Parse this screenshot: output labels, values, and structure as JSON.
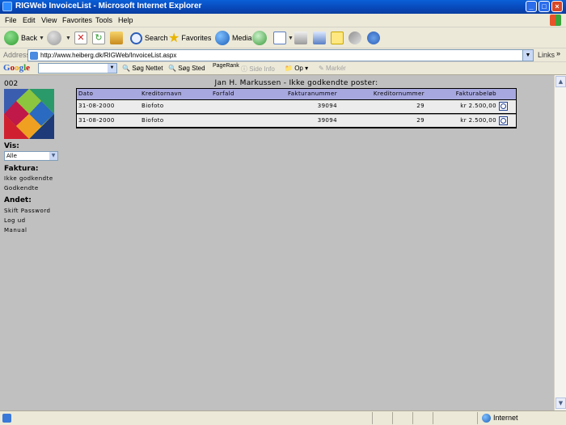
{
  "window": {
    "title": "RIGWeb InvoiceList - Microsoft Internet Explorer"
  },
  "menu": [
    "File",
    "Edit",
    "View",
    "Favorites",
    "Tools",
    "Help"
  ],
  "toolbar": {
    "back": "Back",
    "search": "Search",
    "favorites": "Favorites",
    "media": "Media"
  },
  "address": {
    "label": "Address",
    "url": "http://www.heiberg.dk/RIGWeb/InvoiceList.aspx",
    "links": "Links",
    "more": "»"
  },
  "googlebar": {
    "logo": "Google",
    "search_web": "Søg Nettet",
    "search_site": "Søg Sted",
    "pagerank": "PageRank",
    "page_info": "Side Info",
    "up": "Op",
    "highlight": "Markér"
  },
  "sidebar": {
    "user_id": "002",
    "vis_label": "Vis:",
    "vis_value": "Alle",
    "faktura_heading": "Faktura:",
    "faktura_links": [
      "Ikke godkendte",
      "Godkendte"
    ],
    "andet_heading": "Andet:",
    "andet_links": [
      "Skift Password",
      "Log ud",
      "Manual"
    ]
  },
  "main": {
    "heading": "Jan H. Markussen - Ikke godkendte poster:",
    "columns": [
      "Dato",
      "Kreditornavn",
      "Forfald",
      "Fakturanummer",
      "Kreditornummer",
      "Fakturabeløb"
    ],
    "rows": [
      {
        "dato": "31-08-2000",
        "kreditornavn": "Biofoto",
        "forfald": "",
        "fakturanummer": "39094",
        "kreditornummer": "29",
        "belob": "kr 2.500,00"
      },
      {
        "dato": "31-08-2000",
        "kreditornavn": "Biofoto",
        "forfald": "",
        "fakturanummer": "39094",
        "kreditornummer": "29",
        "belob": "kr 2.500,00"
      }
    ]
  },
  "status": {
    "zone": "Internet"
  }
}
